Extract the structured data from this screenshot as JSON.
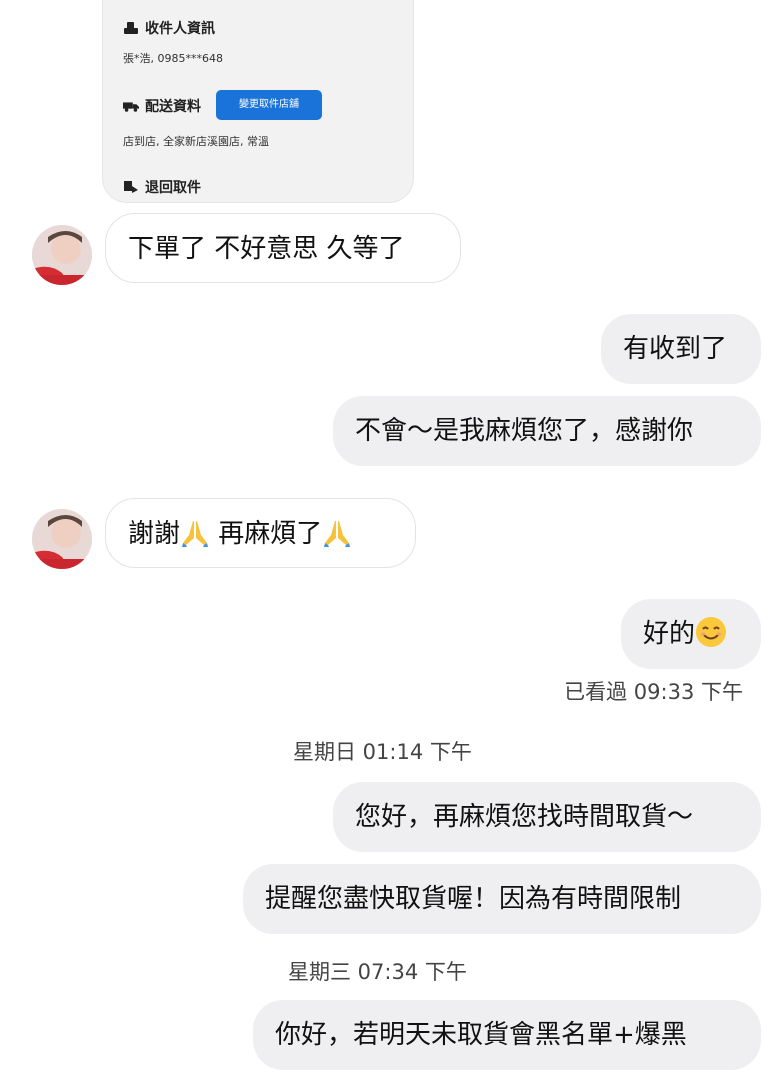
{
  "card": {
    "recipient_title": "收件人資訊",
    "recipient_value": "張*浩, 0985***648",
    "shipping_title": "配送資料",
    "change_store_button": "變更取件店舖",
    "shipping_value": "店到店, 全家新店溪園店, 常溫",
    "return_title": "退回取件"
  },
  "messages": [
    {
      "side": "in",
      "text": "下單了 不好意思 久等了"
    },
    {
      "side": "out",
      "text": "有收到了"
    },
    {
      "side": "out",
      "text": "不會～是我麻煩您了，感謝你"
    },
    {
      "side": "in",
      "text_a": "謝謝",
      "text_b": " 再麻煩了"
    },
    {
      "side": "out",
      "text": "好的"
    },
    {
      "side": "out",
      "text": "您好，再麻煩您找時間取貨～"
    },
    {
      "side": "out",
      "text": "提醒您盡快取貨喔！因為有時間限制"
    },
    {
      "side": "out",
      "text": "你好，若明天未取貨會黑名單+爆黑"
    }
  ],
  "meta": {
    "seen": "已看過 09:33 下午",
    "divider_sunday": "星期日 01:14 下午",
    "divider_wednesday": "星期三 07:34 下午"
  },
  "icons": {
    "recipient": "recipient-icon",
    "shipping": "truck-icon",
    "return": "return-icon",
    "pray": "folded-hands-emoji",
    "smile": "smiling-face-emoji"
  }
}
